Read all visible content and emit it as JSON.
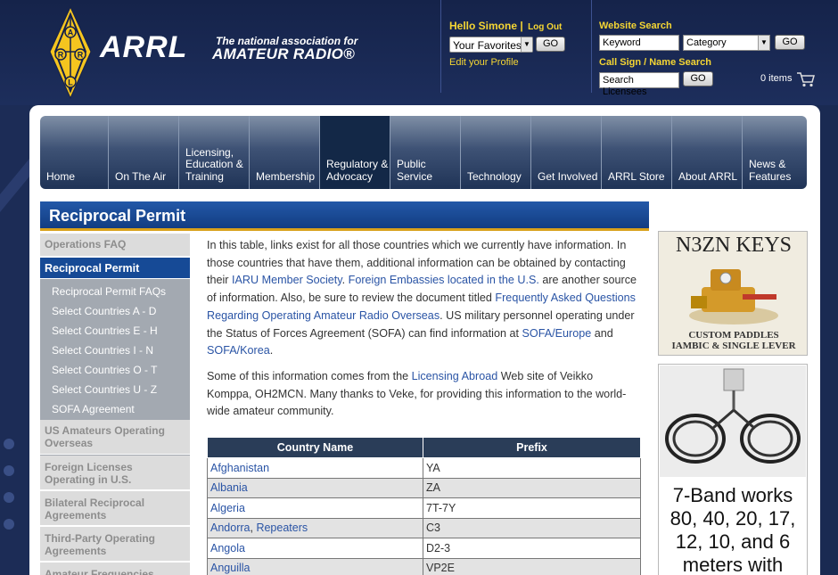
{
  "header": {
    "logo": "ARRL",
    "tagline1": "The national association for",
    "tagline2": "AMATEUR RADIO®",
    "tower_letters": [
      "A",
      "R",
      "R",
      "L"
    ],
    "hello_text": "Hello Simone |",
    "logout_label": "Log Out",
    "favorites_value": "Your Favorites",
    "go_label": "GO",
    "edit_profile_label": "Edit your Profile",
    "website_search_label": "Website Search",
    "keyword_value": "Keyword",
    "category_value": "Category",
    "callsign_label": "Call Sign / Name Search",
    "search_licensees_value": "Search Licensees",
    "cart_text": "0 items"
  },
  "nav": [
    {
      "label": "Home",
      "w": 77
    },
    {
      "label": "On The Air",
      "w": 79
    },
    {
      "label": "Licensing,\nEducation &\nTraining",
      "w": 79
    },
    {
      "label": "Membership",
      "w": 79
    },
    {
      "label": "Regulatory &\nAdvocacy",
      "w": 79,
      "active": true
    },
    {
      "label": "Public\nService",
      "w": 79
    },
    {
      "label": "Technology",
      "w": 79
    },
    {
      "label": "Get Involved",
      "w": 79
    },
    {
      "label": "ARRL Store",
      "w": 79
    },
    {
      "label": "About ARRL",
      "w": 79
    },
    {
      "label": "News &\nFeatures",
      "w": 72
    }
  ],
  "page_title": "Reciprocal Permit",
  "sidebar": {
    "operations_faq": "Operations FAQ",
    "reciprocal_permit": "Reciprocal Permit",
    "sub_items": [
      "Reciprocal Permit FAQs",
      "Select Countries A - D",
      "Select Countries E - H",
      "Select Countries I - N",
      "Select Countries O - T",
      "Select Countries U - Z",
      "SOFA Agreement"
    ],
    "us_amateurs": "US Amateurs Operating Overseas",
    "foreign_licenses": "Foreign Licenses Operating in U.S.",
    "bilateral": "Bilateral Reciprocal Agreements",
    "third_party": "Third-Party Operating Agreements",
    "amateur_freq": "Amateur Frequencies"
  },
  "content": {
    "p1_a": "In this table, links exist for all those countries which we currently have information. In those countries that have them, additional information can be obtained by contacting their ",
    "p1_link1": "IARU Member Society",
    "p1_b": ". ",
    "p1_link2": "Foreign Embassies located in the U.S.",
    "p1_c": " are another source of information. Also, be sure to review the document titled ",
    "p1_link3": "Frequently Asked Questions Regarding Operating Amateur Radio Overseas",
    "p1_d": ". US military personnel operating under the Status of Forces Agreement (SOFA) can find information at ",
    "p1_link4": "SOFA/Europe",
    "p1_e": " and ",
    "p1_link5": "SOFA/Korea",
    "p1_f": ".",
    "p2_a": "Some of this information comes from the ",
    "p2_link": "Licensing Abroad",
    "p2_b": " Web site of Veikko Komppa, OH2MCN. Many thanks to Veke, for providing this information to the world-wide amateur community."
  },
  "table": {
    "headers": [
      "Country Name",
      "Prefix"
    ],
    "rows": [
      {
        "country": "Afghanistan",
        "extra": "",
        "prefix": "YA"
      },
      {
        "country": "Albania",
        "extra": "",
        "prefix": "ZA"
      },
      {
        "country": "Algeria",
        "extra": "",
        "prefix": "7T-7Y"
      },
      {
        "country": "Andorra",
        "extra": "Repeaters",
        "prefix": "C3"
      },
      {
        "country": "Angola",
        "extra": "",
        "prefix": "D2-3"
      },
      {
        "country": "Anguilla",
        "extra": "",
        "prefix": "VP2E"
      }
    ]
  },
  "ads": {
    "ad1_title": "N3ZN KEYS",
    "ad1_line1": "CUSTOM PADDLES",
    "ad1_line2": "IAMBIC & SINGLE LEVER",
    "ad2_text": "7-Band works 80, 40, 20, 17, 12, 10, and 6 meters with"
  },
  "colors": {
    "header_bg": "#1a2a52",
    "accent_yellow": "#f5d633",
    "nav_active": "#132847",
    "title_blue": "#164a96",
    "link": "#2a54a5"
  }
}
